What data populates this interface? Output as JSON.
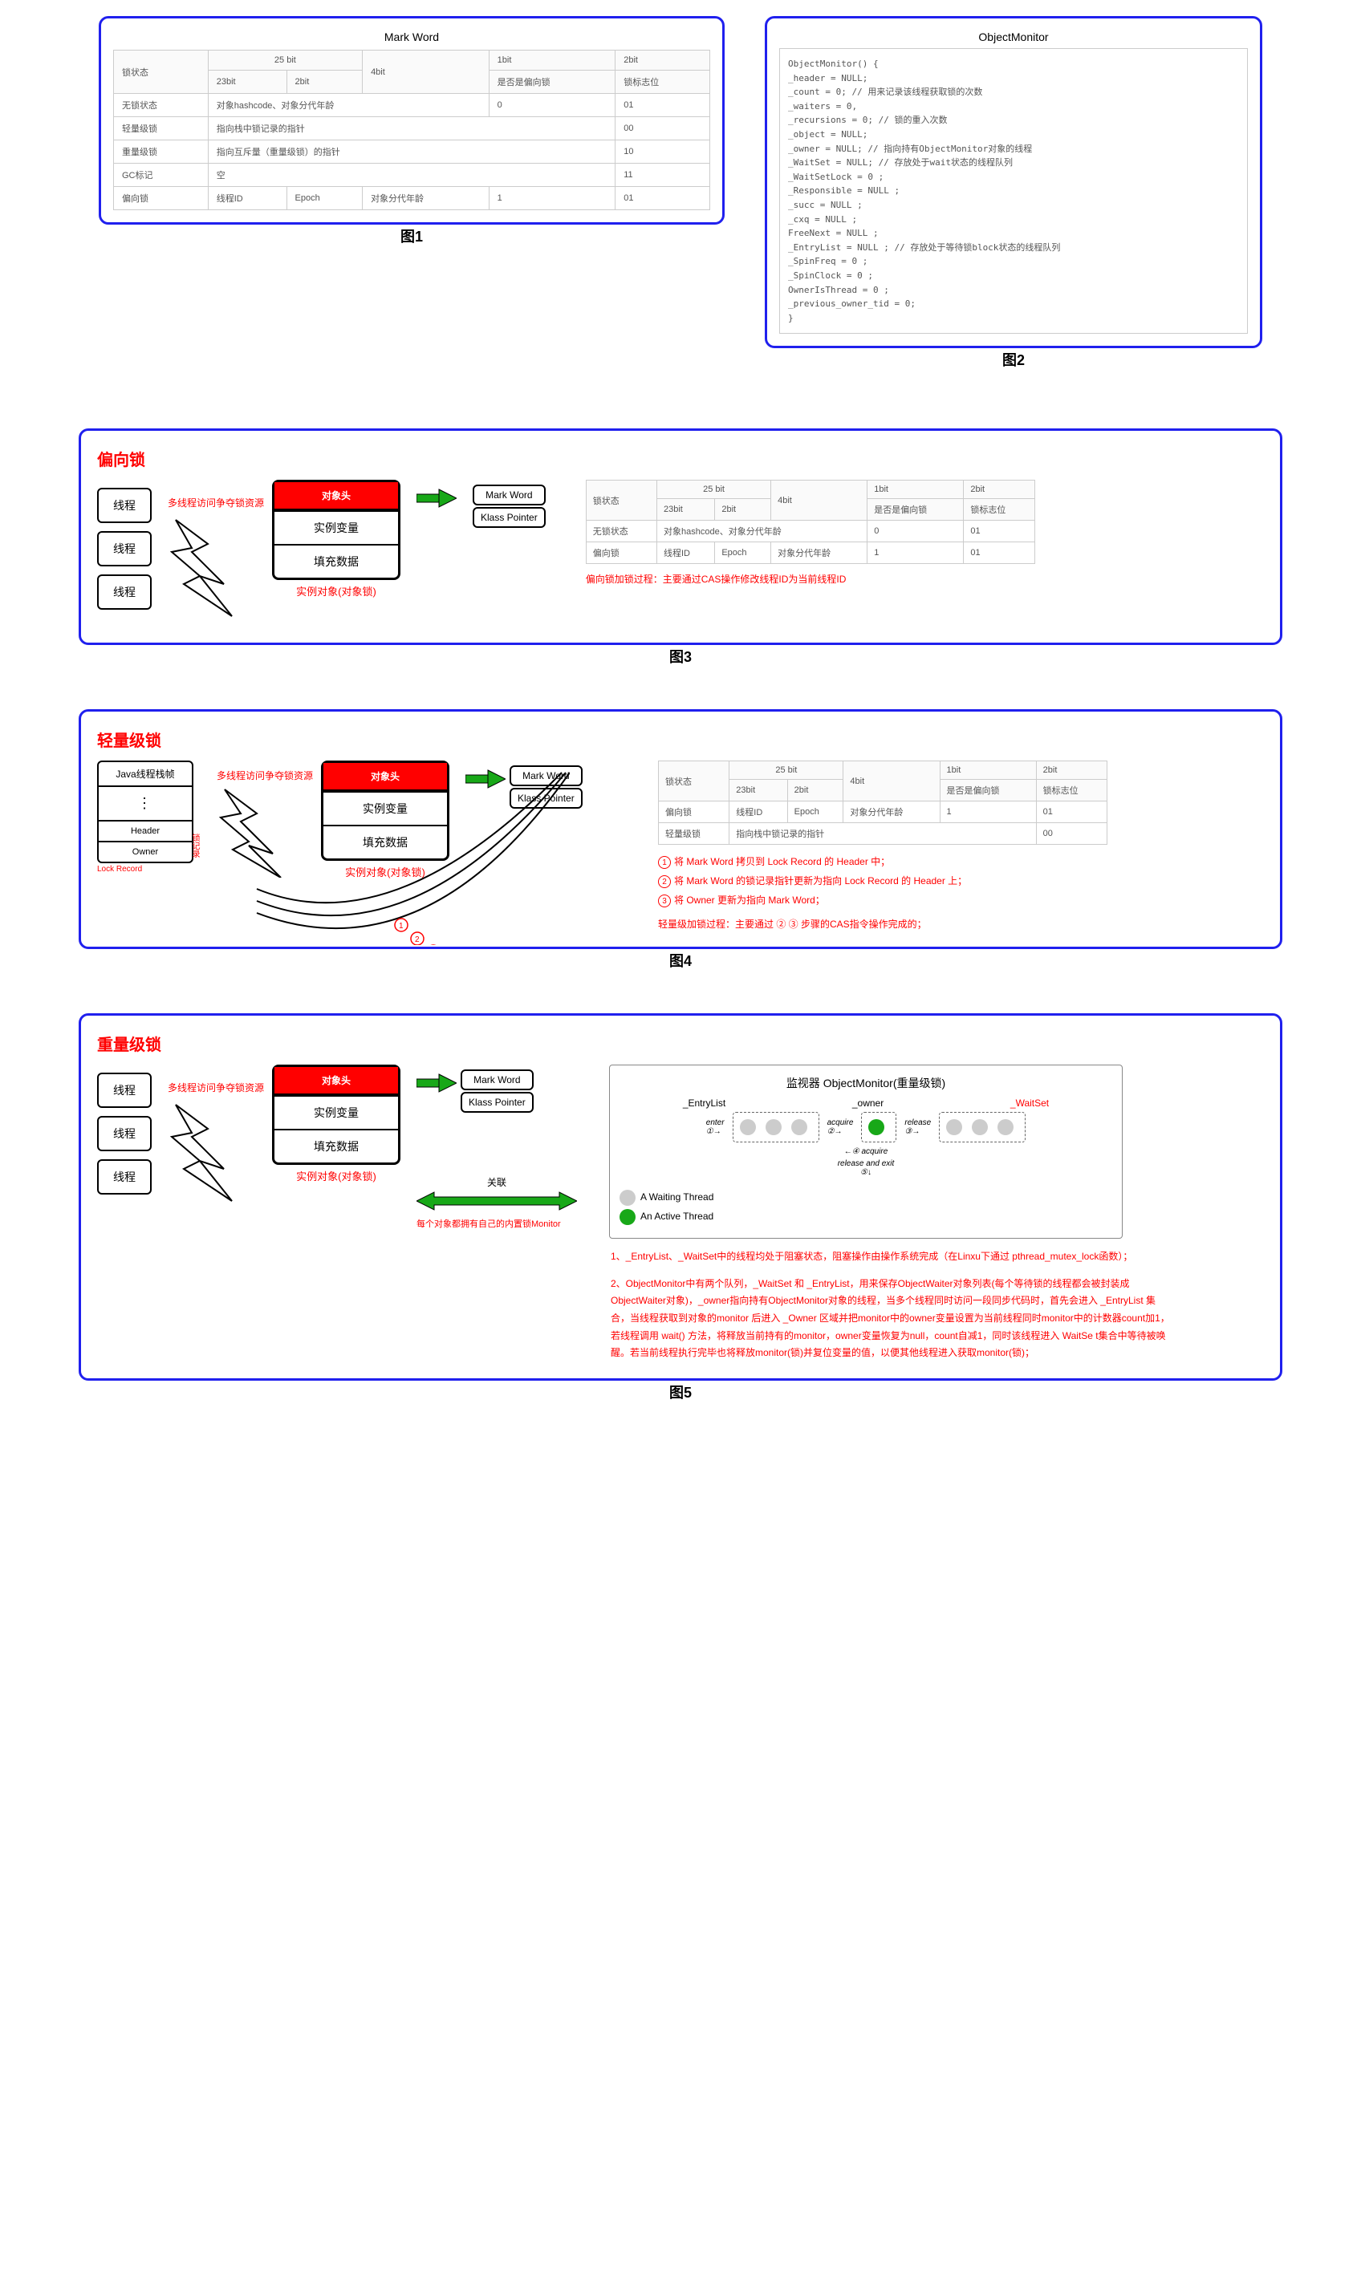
{
  "labels": {
    "fig1": "图1",
    "fig2": "图2",
    "fig3": "图3",
    "fig4": "图4",
    "fig5": "图5"
  },
  "fig1": {
    "title": "Mark Word",
    "headers": {
      "state": "锁状态",
      "b25": "25 bit",
      "b4": "4bit",
      "b1": "1bit",
      "b2": "2bit",
      "b23": "23bit",
      "b2s": "2bit",
      "bias": "是否是偏向锁",
      "flag": "锁标志位"
    },
    "row1": {
      "c0": "无锁状态",
      "c1": "对象hashcode、对象分代年龄",
      "c2": "",
      "c3": "0",
      "c4": "01"
    },
    "row2": {
      "c0": "轻量级锁",
      "c1": "指向栈中锁记录的指针",
      "c2": "",
      "c3": "",
      "c4": "00"
    },
    "row3": {
      "c0": "重量级锁",
      "c1": "指向互斥量（重量级锁）的指针",
      "c2": "",
      "c3": "",
      "c4": "10"
    },
    "row4": {
      "c0": "GC标记",
      "c1": "空",
      "c2": "",
      "c3": "",
      "c4": "11"
    },
    "row5": {
      "c0": "偏向锁",
      "c1": "线程ID",
      "c2": "Epoch",
      "c3": "对象分代年龄",
      "c4": "1",
      "c5": "01"
    }
  },
  "fig2": {
    "title": "ObjectMonitor",
    "lines": [
      "ObjectMonitor() {",
      "    _header       = NULL;",
      "    _count        = 0; // 用来记录该线程获取锁的次数",
      "    _waiters      = 0,",
      "    _recursions   = 0; // 锁的重入次数",
      "    _object       = NULL;",
      "    _owner        = NULL; // 指向持有ObjectMonitor对象的线程",
      "    _WaitSet      = NULL; // 存放处于wait状态的线程队列",
      "    _WaitSetLock  = 0 ;",
      "    _Responsible  = NULL ;",
      "    _succ         = NULL ;",
      "    _cxq          = NULL ;",
      "    FreeNext      = NULL ;",
      "    _EntryList    = NULL ; // 存放处于等待锁block状态的线程队列",
      "    _SpinFreq     = 0 ;",
      "    _SpinClock    = 0 ;",
      "    OwnerIsThread = 0 ;",
      "    _previous_owner_tid = 0;",
      "}"
    ]
  },
  "common": {
    "thread": "线程",
    "competition": "多线程访问争夺锁资源",
    "objhead": "对象头",
    "instance": "实例变量",
    "padding": "填充数据",
    "objlabel": "实例对象(对象锁)",
    "mw": "Mark Word",
    "kp": "Klass Pointer"
  },
  "fig3": {
    "title": "偏向锁",
    "tbl": {
      "h": {
        "state": "锁状态",
        "b25": "25 bit",
        "b4": "4bit",
        "b1": "1bit",
        "b2": "2bit",
        "b23": "23bit",
        "b2s": "2bit",
        "bias": "是否是偏向锁",
        "flag": "锁标志位"
      },
      "r1": {
        "c0": "无锁状态",
        "c1": "对象hashcode、对象分代年龄",
        "c3": "0",
        "c4": "01"
      },
      "r2": {
        "c0": "偏向锁",
        "c1": "线程ID",
        "c2": "Epoch",
        "c3": "对象分代年龄",
        "c4": "1",
        "c5": "01"
      }
    },
    "note": "偏向锁加锁过程：主要通过CAS操作修改线程ID为当前线程ID"
  },
  "fig4": {
    "title": "轻量级锁",
    "javaStack": {
      "head": "Java线程栈帧",
      "header": "Header",
      "owner": "Owner",
      "lockRec": "锁记录",
      "lr": "Lock Record"
    },
    "tbl": {
      "h": {
        "state": "锁状态",
        "b25": "25 bit",
        "b4": "4bit",
        "b1": "1bit",
        "b2": "2bit",
        "b23": "23bit",
        "b2s": "2bit",
        "bias": "是否是偏向锁",
        "flag": "锁标志位"
      },
      "r1": {
        "c0": "偏向锁",
        "c1": "线程ID",
        "c2": "Epoch",
        "c3": "对象分代年龄",
        "c4": "1",
        "c5": "01"
      },
      "r2": {
        "c0": "轻量级锁",
        "c1": "指向栈中锁记录的指针",
        "c4": "00"
      }
    },
    "steps": {
      "s1": "将 Mark Word 拷贝到 Lock Record 的 Header 中；",
      "s2": "将 Mark Word 的锁记录指针更新为指向 Lock Record 的 Header 上；",
      "s3": "将 Owner 更新为指向 Mark Word；"
    },
    "note": "轻量级加锁过程：主要通过 ② ③ 步骤的CAS指令操作完成的；"
  },
  "fig5": {
    "title": "重量级锁",
    "assoc": "关联",
    "monitorNote": "每个对象都拥有自己的内置锁Monitor",
    "monTitle": "监视器 ObjectMonitor(重量级锁)",
    "entryList": "_EntryList",
    "owner": "_owner",
    "waitSet": "_WaitSet",
    "enter": "enter",
    "acq": "acquire",
    "rel": "release",
    "relExit": "release and exit",
    "leg1": "A Waiting Thread",
    "leg2": "An Active Thread",
    "note1": "1、_EntryList、_WaitSet中的线程均处于阻塞状态，阻塞操作由操作系统完成（在Linxu下通过 pthread_mutex_lock函数）；",
    "note2": "2、ObjectMonitor中有两个队列，_WaitSet 和 _EntryList，用来保存ObjectWaiter对象列表(每个等待锁的线程都会被封装成ObjectWaiter对象)，_owner指向持有ObjectMonitor对象的线程，当多个线程同时访问一段同步代码时，首先会进入 _EntryList 集合，当线程获取到对象的monitor 后进入 _Owner 区域并把monitor中的owner变量设置为当前线程同时monitor中的计数器count加1，若线程调用 wait() 方法，将释放当前持有的monitor，owner变量恢复为null，count自减1，同时该线程进入 WaitSe t集合中等待被唤醒。若当前线程执行完毕也将释放monitor(锁)并复位变量的值，以便其他线程进入获取monitor(锁)；"
  }
}
